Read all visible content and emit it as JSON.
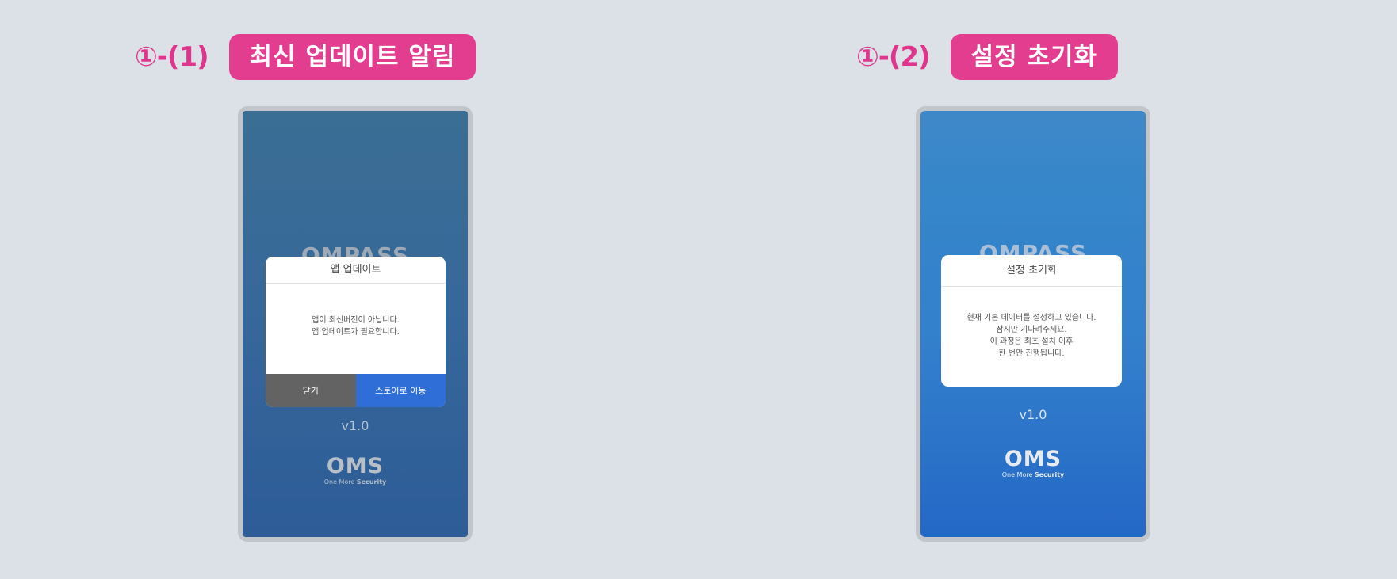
{
  "sections": [
    {
      "step": "①-(1)",
      "title": "최신 업데이트 알림",
      "screen": {
        "bg_logo": "OMPASS",
        "dialog": {
          "title": "앱 업데이트",
          "body": [
            "앱이 최신버전이 아닙니다.",
            "앱 업데이트가 필요합니다."
          ],
          "close_label": "닫기",
          "store_label": "스토어로 이동"
        },
        "version": "v1.0",
        "logo": {
          "mark": "OMS",
          "sub_plain": "One More ",
          "sub_bold": "Security"
        }
      }
    },
    {
      "step": "①-(2)",
      "title": "설정 초기화",
      "screen": {
        "bg_logo": "OMPASS",
        "dialog": {
          "title": "설정 초기화",
          "body": [
            "현재 기본 데이터를 설정하고 있습니다.",
            "잠시만 기다려주세요.",
            "이 과정은 최초 설치 이후",
            "한 번만 진행됩니다."
          ]
        },
        "version": "v1.0",
        "logo": {
          "mark": "OMS",
          "sub_plain": "One More ",
          "sub_bold": "Security"
        }
      }
    }
  ],
  "colors": {
    "accent_pink": "#e33d8f",
    "page_bg": "#dbe1e7",
    "button_blue": "#2f6ed6",
    "button_gray": "#636363"
  }
}
